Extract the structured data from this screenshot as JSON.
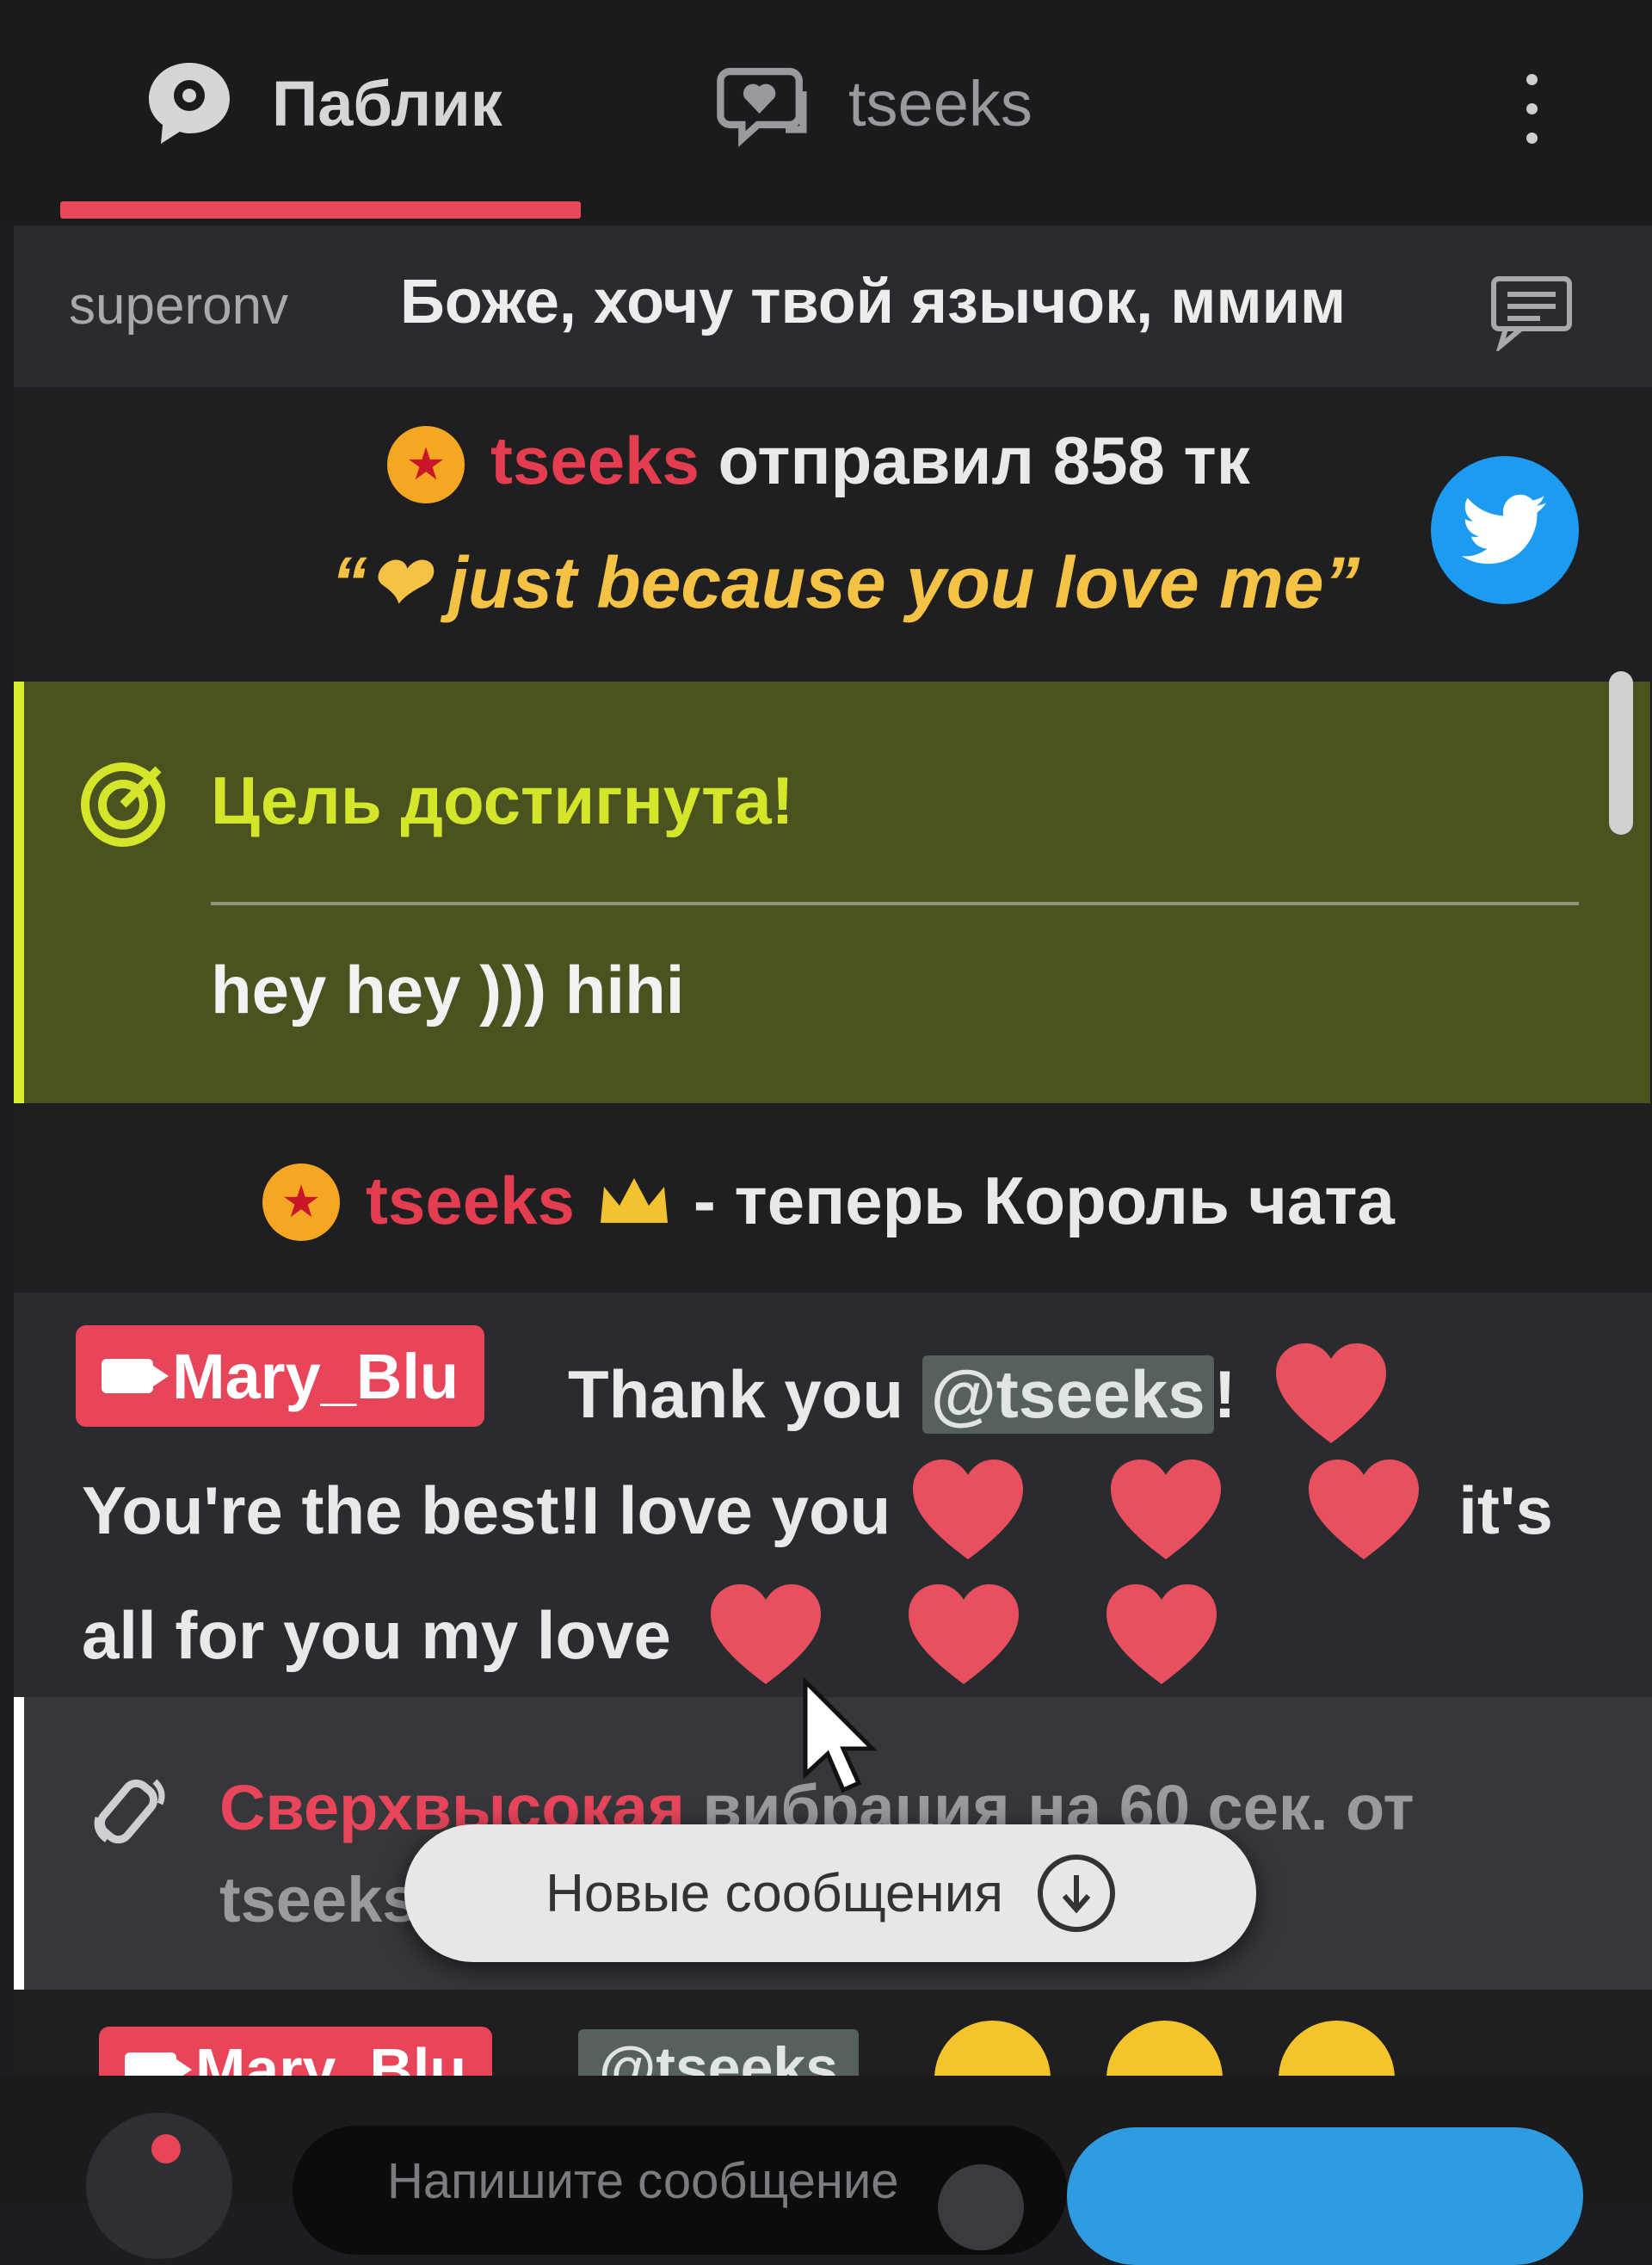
{
  "tabs": {
    "public_label": "Паблик",
    "private_label": "tseeks"
  },
  "pinned": {
    "user": "superonv",
    "text": "Боже, хочу твой язычок, ммим"
  },
  "tip": {
    "user": "tseeks",
    "action": "отправил 858 тк",
    "quote": "“❤ just because you love me”"
  },
  "goal": {
    "title": "Цель достигнута!",
    "text": "hey hey ))) hihi"
  },
  "king": {
    "user": "tseeks",
    "text": "- теперь Король чата"
  },
  "message": {
    "user": "Mary_Blu",
    "text_before": "Thank you ",
    "mention": "@tseeks",
    "text_after": "!",
    "line2": "You're the best!I love you",
    "line2_end": "it's",
    "line3": "all for you my love"
  },
  "vibration": {
    "highlight": "Сверхвысокая",
    "text": " вибрация на 60 сек. от",
    "user": "tseeks"
  },
  "new_messages_label": "Новые сообщения",
  "partial_row": {
    "user": "Mary_Blu",
    "mention": "@tseeks"
  },
  "input": {
    "placeholder": "Напишите сообщение"
  },
  "colors": {
    "accent_red": "#e8455b",
    "goal_green": "#d7ee2a",
    "tip_gold": "#f4c244",
    "twitter_blue": "#1d9bf0"
  }
}
